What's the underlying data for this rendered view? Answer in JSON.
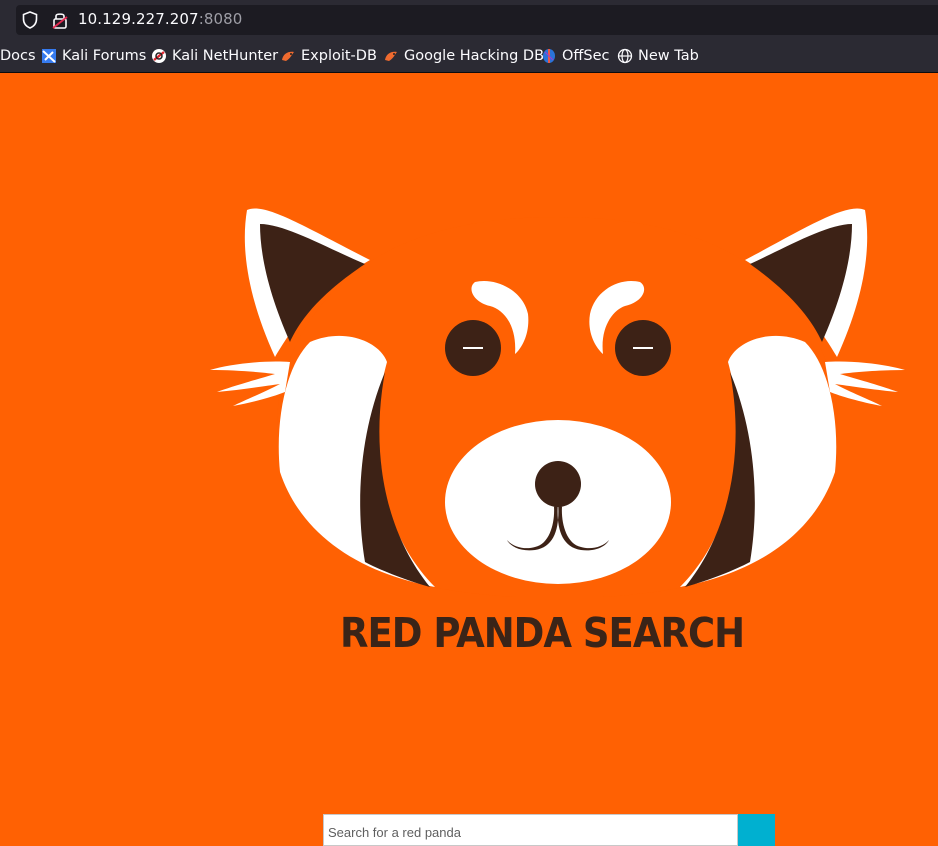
{
  "browser": {
    "url_host": "10.129.227.207",
    "url_port": ":8080",
    "bookmarks": [
      "Docs",
      "Kali Forums",
      "Kali NetHunter",
      "Exploit-DB",
      "Google Hacking DB",
      "OffSec",
      "New Tab"
    ]
  },
  "page": {
    "title": "RED PANDA SEARCH",
    "search_placeholder": "Search for a red panda"
  },
  "colors": {
    "background": "#ff6103",
    "panda_dark": "#3d2216",
    "search_button": "#00b0d0"
  }
}
